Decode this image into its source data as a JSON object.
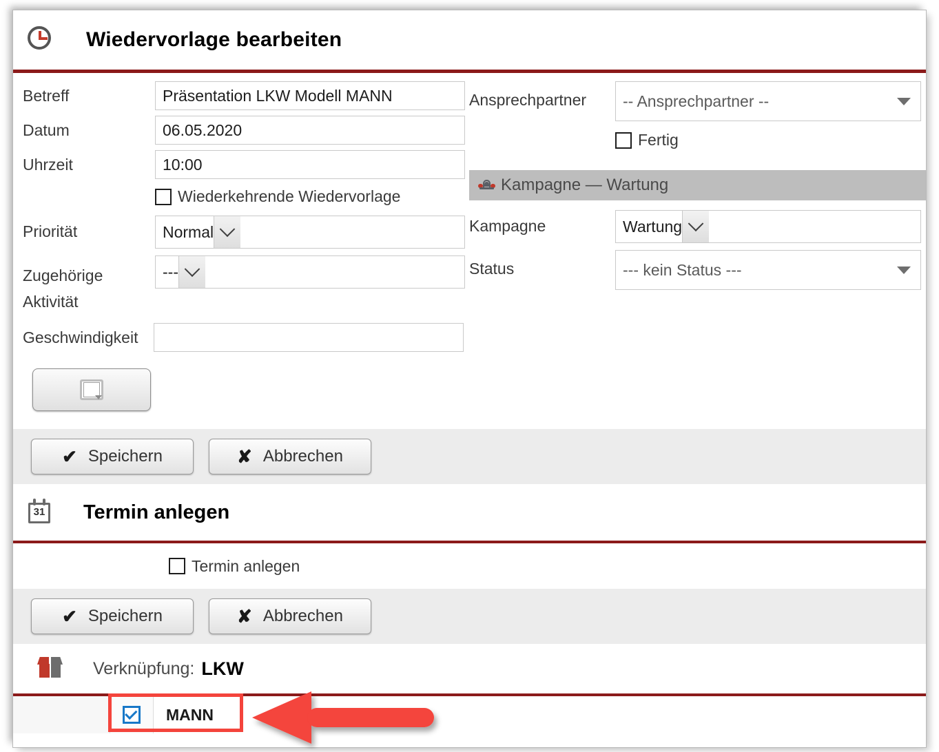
{
  "window": {
    "title": "Wiedervorlage bearbeiten",
    "title_icon": "clock-icon",
    "accent_color": "#8b1a1a"
  },
  "form": {
    "left": {
      "betreff": {
        "label": "Betreff",
        "value": "Präsentation LKW Modell MANN"
      },
      "datum": {
        "label": "Datum",
        "value": "06.05.2020"
      },
      "uhrzeit": {
        "label": "Uhrzeit",
        "value": "10:00"
      },
      "wiederkehrend": {
        "label": "Wiederkehrende Wiedervorlage",
        "checked": false
      },
      "prioritaet": {
        "label": "Priorität",
        "value": "Normal"
      },
      "zugehoerige_aktivitaet": {
        "label_line1": "Zugehörige",
        "label_line2": "Aktivität",
        "value": "---"
      },
      "geschwindigkeit": {
        "label": "Geschwindigkeit",
        "value": ""
      },
      "memo_button": {
        "icon": "memo-icon"
      }
    },
    "right": {
      "ansprechpartner": {
        "label": "Ansprechpartner",
        "value": "-- Ansprechpartner --"
      },
      "fertig": {
        "label": "Fertig",
        "checked": false
      },
      "section": {
        "title": "Kampagne — Wartung",
        "icon": "campaign-icon"
      },
      "kampagne": {
        "label": "Kampagne",
        "value": "Wartung"
      },
      "status": {
        "label": "Status",
        "value": "--- kein Status ---"
      }
    }
  },
  "actions_primary": {
    "save_label": "Speichern",
    "save_icon": "check-icon",
    "cancel_label": "Abbrechen",
    "cancel_icon": "cross-icon"
  },
  "termin_section": {
    "title": "Termin anlegen",
    "title_icon": "calendar-icon",
    "checkbox_label": "Termin anlegen",
    "checkbox_checked": false,
    "save_label": "Speichern",
    "save_icon": "check-icon",
    "cancel_label": "Abbrechen",
    "cancel_icon": "cross-icon"
  },
  "link_section": {
    "icon": "open-box-icon",
    "label": "Verknüpfung:",
    "value": "LKW",
    "row": {
      "name": "MANN",
      "checked": true,
      "checkbox_color": "#1878c8",
      "highlight_color": "#f4443c"
    }
  },
  "annotation": {
    "arrow": "red-left-arrow",
    "arrow_color": "#f4443c"
  },
  "glyphs": {
    "check": "✔",
    "cross": "✘",
    "cal_day": "31"
  }
}
